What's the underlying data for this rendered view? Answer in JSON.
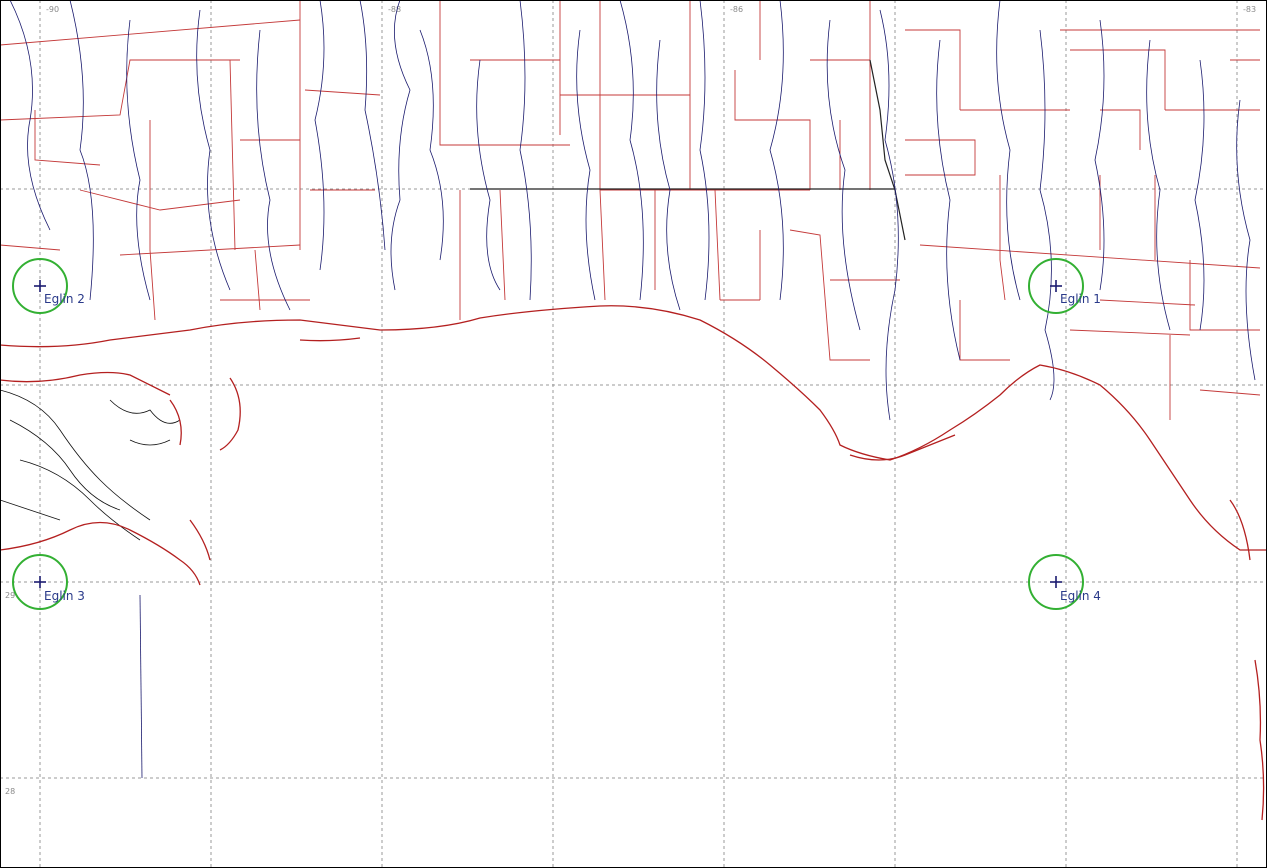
{
  "grid": {
    "lon_labels": [
      {
        "id": "lon-90",
        "label": "-90"
      },
      {
        "id": "lon-88",
        "label": "-88"
      },
      {
        "id": "lon-86",
        "label": "-86"
      },
      {
        "id": "lon-83",
        "label": "-83"
      }
    ],
    "lat_labels": [
      {
        "id": "lat-29",
        "label": "29"
      },
      {
        "id": "lat-28",
        "label": "28"
      }
    ]
  },
  "sites": [
    {
      "id": "eglin-1",
      "name": "Eglin 1"
    },
    {
      "id": "eglin-2",
      "name": "Eglin 2"
    },
    {
      "id": "eglin-3",
      "name": "Eglin 3"
    },
    {
      "id": "eglin-4",
      "name": "Eglin 4"
    }
  ],
  "colors": {
    "coastline": "#b42020",
    "county_lines": "#c43a3a",
    "rivers": "#1a1a6e",
    "site_rings": "#33b033",
    "grid": "#9a9a9a"
  }
}
